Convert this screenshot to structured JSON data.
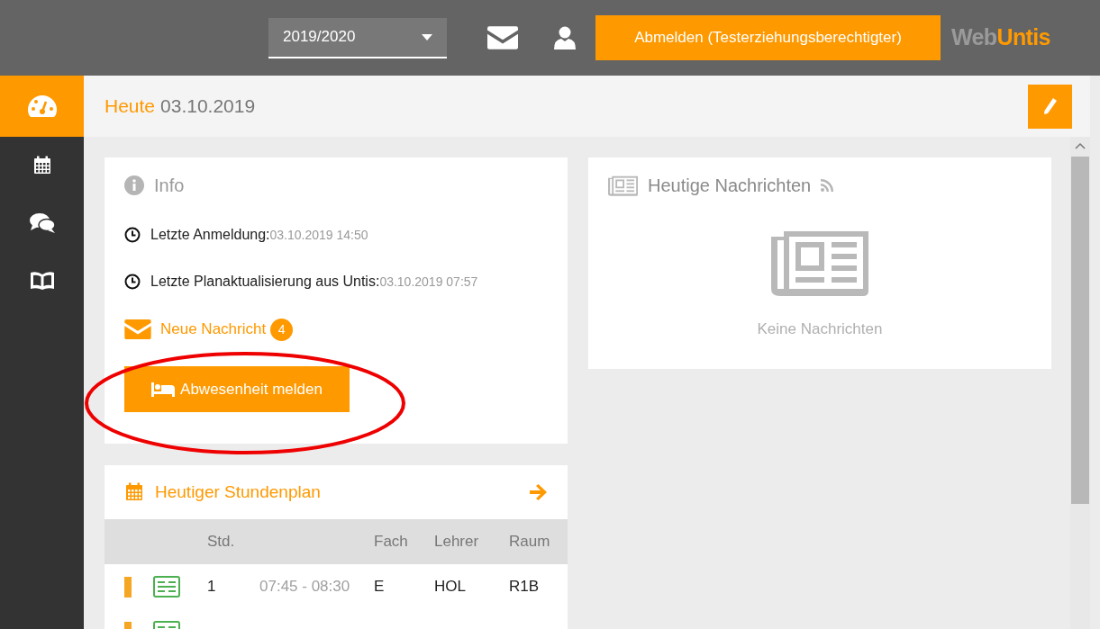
{
  "top_bar": {
    "school_year": "2019/2020",
    "logout_button": "Abmelden (Testerziehungsberechtigter)",
    "logo": {
      "part_1": "Web",
      "part_2": "Untis"
    }
  },
  "sidebar": {
    "items": [
      {
        "selected": true
      },
      {
        "selected": false
      },
      {
        "selected": false
      },
      {
        "selected": false
      }
    ]
  },
  "header": {
    "label": "Heute",
    "date": "03.10.2019"
  },
  "info": {
    "title": "Info",
    "lines": [
      {
        "label": "Letzte Anmeldung:",
        "value": "03.10.2019 14:50"
      },
      {
        "label": "Letzte Planaktualisierung aus Untis:",
        "value": "03.10.2019 07:57"
      }
    ],
    "new_message": {
      "label": "Neue Nachricht",
      "count": "4"
    },
    "absence_button": "Abwesenheit melden"
  },
  "news": {
    "title": "Heutige Nachrichten",
    "empty_text": "Keine Nachrichten"
  },
  "timetable": {
    "title": "Heutiger Stundenplan",
    "columns": [
      "Std.",
      "Fach",
      "Lehrer",
      "Raum"
    ],
    "rows": [
      {
        "color": "#f5a623",
        "period": "1",
        "time": "07:45 - 08:30",
        "subject": "E",
        "teacher": "HOL",
        "room": "R1B"
      },
      {
        "color": "#f5a623"
      }
    ]
  }
}
